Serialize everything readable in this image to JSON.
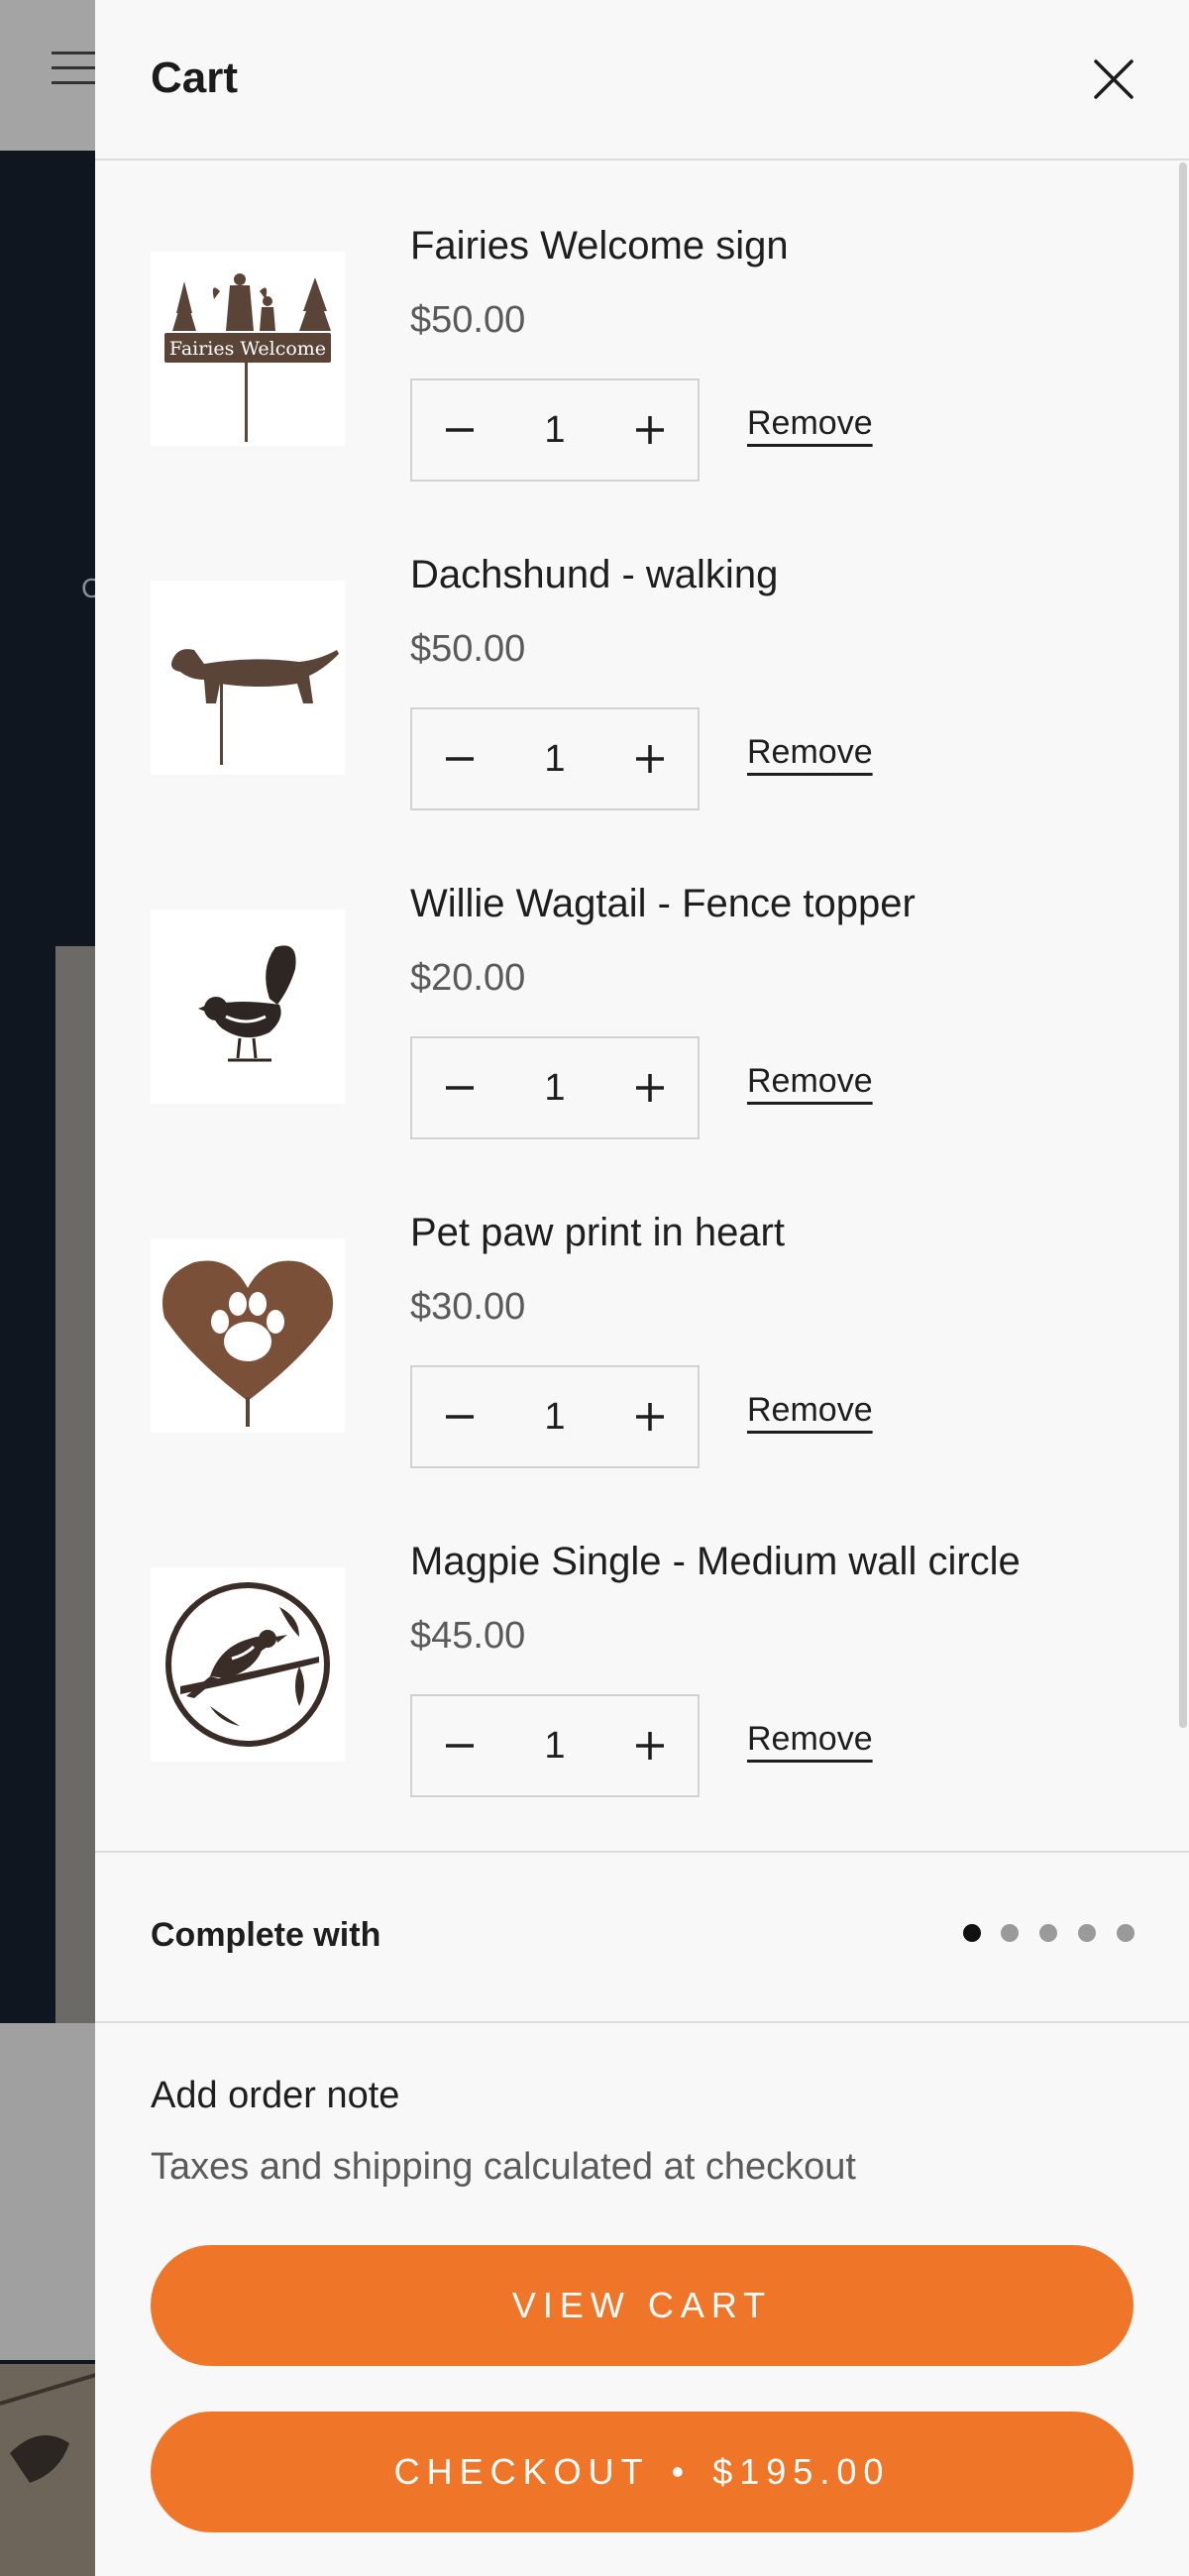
{
  "cart": {
    "title": "Cart",
    "items": [
      {
        "name": "Fairies Welcome sign",
        "price": "$50.00",
        "quantity": "1",
        "remove_label": "Remove",
        "image_text": "Fairies Welcome"
      },
      {
        "name": "Dachshund - walking",
        "price": "$50.00",
        "quantity": "1",
        "remove_label": "Remove"
      },
      {
        "name": "Willie Wagtail - Fence topper",
        "price": "$20.00",
        "quantity": "1",
        "remove_label": "Remove"
      },
      {
        "name": "Pet paw print in heart",
        "price": "$30.00",
        "quantity": "1",
        "remove_label": "Remove"
      },
      {
        "name": "Magpie Single - Medium wall circle",
        "price": "$45.00",
        "quantity": "1",
        "remove_label": "Remove"
      }
    ],
    "complete_with": {
      "label": "Complete with",
      "dot_count": 5,
      "active_dot": 0
    },
    "order_note_label": "Add order note",
    "tax_note": "Taxes and shipping calculated at checkout",
    "view_cart_label": "VIEW CART",
    "checkout_label": "CHECKOUT",
    "checkout_separator": "•",
    "checkout_total": "$195.00"
  },
  "background": {
    "hero_letter": "C"
  },
  "icons": {
    "close": "close-icon",
    "minus": "minus-icon",
    "plus": "plus-icon",
    "menu": "menu-icon"
  },
  "colors": {
    "accent": "#ef7629",
    "drawer_bg": "#f8f8f8",
    "text": "#1e1e1e",
    "muted": "#5a5a5a",
    "product_metal": "#5a4438"
  }
}
